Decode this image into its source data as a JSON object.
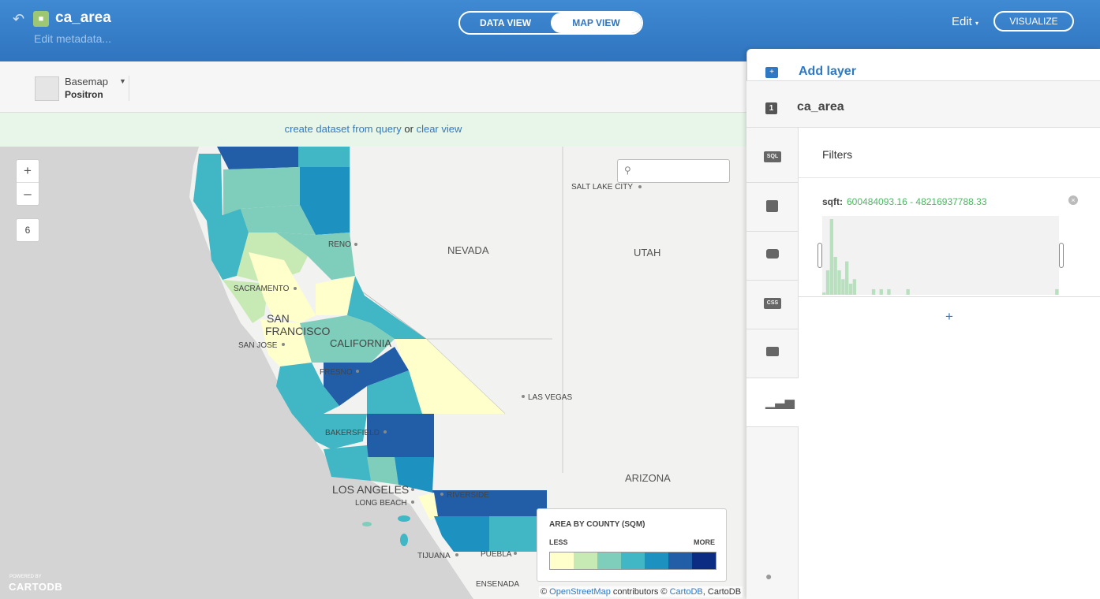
{
  "header": {
    "back_icon": "back-arrow-icon",
    "title": "ca_area",
    "meta_link": "Edit metadata...",
    "toggle": {
      "data_view": "DATA VIEW",
      "map_view": "MAP VIEW"
    },
    "edit": "Edit",
    "visualize": "VISUALIZE"
  },
  "toolbar": {
    "basemap_label": "Basemap",
    "basemap_value": "Positron"
  },
  "querybar": {
    "create_link": "create dataset from query",
    "or": "or",
    "clear_link": "clear view"
  },
  "map": {
    "zoom_level": "6",
    "zoom_in": "+",
    "zoom_out": "–",
    "labels": {
      "salt_lake_city": "SALT LAKE CITY",
      "reno": "RENO",
      "nevada": "NEVADA",
      "utah": "UTAH",
      "sacramento": "SACRAMENTO",
      "san_francisco_1": "SAN",
      "san_francisco_2": "FRANCISCO",
      "san_jose": "SAN JOSE",
      "california": "CALIFORNIA",
      "fresno": "FRESNO",
      "las_vegas": "LAS VEGAS",
      "bakersfield": "BAKERSFIELD",
      "arizona": "ARIZONA",
      "los_angeles": "LOS ANGELES",
      "long_beach": "LONG BEACH",
      "riverside": "RIVERSIDE",
      "tijuana": "TIJUANA",
      "puebla": "PUEBLA",
      "ensenada": "ENSENADA"
    },
    "attribution": {
      "prefix": "©",
      "osm": "OpenStreetMap",
      "mid": "contributors ©",
      "cartodb": "CartoDB",
      "suffix": ", CartoDB"
    },
    "powered": "POWERED BY",
    "brand": "CARTODB"
  },
  "legend": {
    "title": "AREA BY COUNTY (SQM)",
    "less": "LESS",
    "more": "MORE",
    "colors": [
      "#ffffcc",
      "#c7e9b4",
      "#7fcdbb",
      "#41b6c4",
      "#1d91c0",
      "#225ea8",
      "#0c2c84"
    ]
  },
  "panel": {
    "add_layer": "Add layer",
    "layer_number": "1",
    "layer_name": "ca_area",
    "sidebar_icons": [
      "SQL",
      "wizard",
      "infowindow",
      "CSS",
      "legends",
      "filters"
    ],
    "filters_title": "Filters",
    "filter_column": "sqft:",
    "filter_range": "600484093.16 - 48216937788.33",
    "add_filter": "+",
    "histogram": [
      2,
      22,
      68,
      34,
      22,
      14,
      30,
      10,
      14,
      0,
      0,
      0,
      0,
      5,
      0,
      5,
      0,
      5,
      0,
      0,
      0,
      0,
      5,
      0,
      0,
      0,
      0,
      0,
      0,
      0,
      0,
      0,
      0,
      0,
      0,
      0,
      0,
      0,
      0,
      0,
      0,
      0,
      0,
      0,
      0,
      0,
      0,
      0,
      0,
      0,
      0,
      0,
      0,
      0,
      0,
      0,
      0,
      0,
      0,
      0,
      0,
      5
    ]
  }
}
